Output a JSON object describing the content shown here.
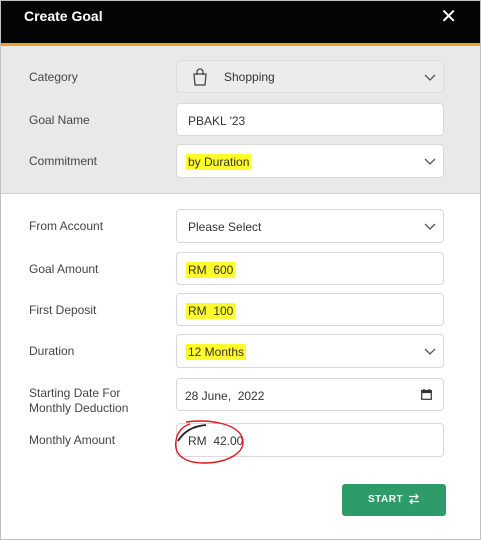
{
  "dialog": {
    "title": "Create Goal",
    "close_symbol": "✕"
  },
  "form": {
    "category": {
      "label": "Category",
      "value": "Shopping",
      "icon": "shopping-bag-icon"
    },
    "goal_name": {
      "label": "Goal Name",
      "value": "PBAKL '23"
    },
    "commitment": {
      "label": "Commitment",
      "value": "by Duration"
    },
    "from_account": {
      "label": "From Account",
      "value": "Please Select"
    },
    "goal_amount": {
      "label": "Goal Amount",
      "value": "RM  600"
    },
    "first_deposit": {
      "label": "First Deposit",
      "value": "RM  100"
    },
    "duration": {
      "label": "Duration",
      "value": "12 Months"
    },
    "starting_date": {
      "label_line1": "Starting Date For",
      "label_line2": "Monthly Deduction",
      "value": "28 June,  2022"
    },
    "monthly_amount": {
      "label": "Monthly Amount",
      "value": "RM  42.00"
    }
  },
  "actions": {
    "start_label": "START"
  },
  "colors": {
    "header_bg": "#050505",
    "accent": "#f0a41a",
    "highlight": "#fffb2d",
    "start_button": "#2e9c6a",
    "annotation_red": "#e0141e"
  }
}
